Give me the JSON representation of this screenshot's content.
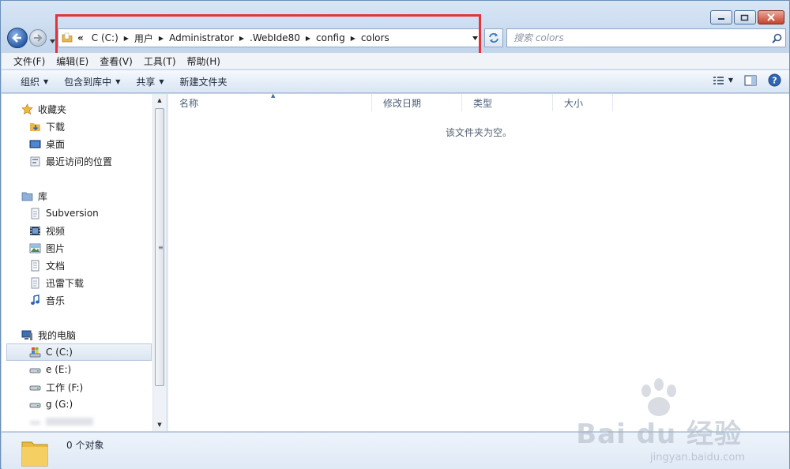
{
  "window": {
    "caption": {
      "minimize": "minimize",
      "maximize": "maximize",
      "close": "close"
    }
  },
  "address": {
    "overflow": "«",
    "crumbs": [
      "C (C:)",
      "用户",
      "Administrator",
      ".WebIde80",
      "config",
      "colors"
    ]
  },
  "search": {
    "placeholder": "搜索 colors"
  },
  "menu": [
    "文件(F)",
    "编辑(E)",
    "查看(V)",
    "工具(T)",
    "帮助(H)"
  ],
  "commands": {
    "organize": "组织",
    "include_in_library": "包含到库中",
    "share": "共享",
    "new_folder": "新建文件夹"
  },
  "nav": {
    "favorites": {
      "label": "收藏夹",
      "items": [
        "下载",
        "桌面",
        "最近访问的位置"
      ]
    },
    "libraries": {
      "label": "库",
      "items": [
        "Subversion",
        "视频",
        "图片",
        "文档",
        "迅雷下载",
        "音乐"
      ]
    },
    "computer": {
      "label": "我的电脑",
      "items": [
        "C (C:)",
        "e (E:)",
        "工作 (F:)",
        "g (G:)"
      ],
      "selected_index": 0
    }
  },
  "columns": [
    "名称",
    "修改日期",
    "类型",
    "大小"
  ],
  "content": {
    "empty_message": "该文件夹为空。"
  },
  "details": {
    "count": "0 个对象"
  },
  "watermark": {
    "brand": "Bai du 经验",
    "url": "jingyan.baidu.com"
  },
  "colors": {
    "accent": "#2a5ca8",
    "highlight": "#e4343a",
    "close": "#c7432c"
  }
}
